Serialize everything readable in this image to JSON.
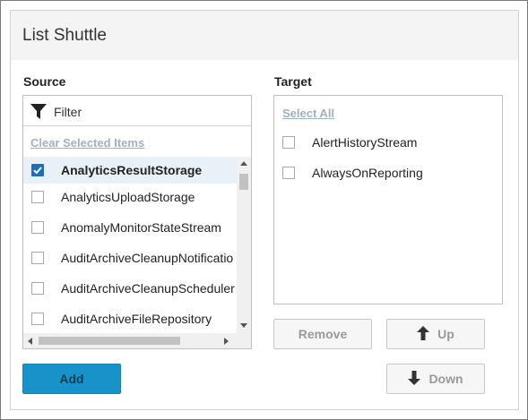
{
  "panel": {
    "title": "List Shuttle"
  },
  "source": {
    "label": "Source",
    "filter_placeholder": "Filter",
    "clear_link": "Clear Selected Items",
    "items": [
      {
        "label": "AnalyticsResultStorage",
        "checked": true
      },
      {
        "label": "AnalyticsUploadStorage",
        "checked": false
      },
      {
        "label": "AnomalyMonitorStateStream",
        "checked": false
      },
      {
        "label": "AuditArchiveCleanupNotificatio",
        "checked": false
      },
      {
        "label": "AuditArchiveCleanupScheduler",
        "checked": false
      },
      {
        "label": "AuditArchiveFileRepository",
        "checked": false
      }
    ]
  },
  "target": {
    "label": "Target",
    "select_all": "Select All",
    "items": [
      {
        "label": "AlertHistoryStream",
        "checked": false
      },
      {
        "label": "AlwaysOnReporting",
        "checked": false
      }
    ]
  },
  "buttons": {
    "add": "Add",
    "remove": "Remove",
    "up": "Up",
    "down": "Down"
  },
  "icons": {
    "filter": "filter-icon",
    "check": "check-icon",
    "up": "arrow-up-icon",
    "down": "arrow-down-icon"
  },
  "colors": {
    "primary_button": "#1793c9",
    "checkbox_checked": "#1f6fb8",
    "selected_row": "#e8f1f8",
    "link_disabled": "#9fb1c0"
  }
}
